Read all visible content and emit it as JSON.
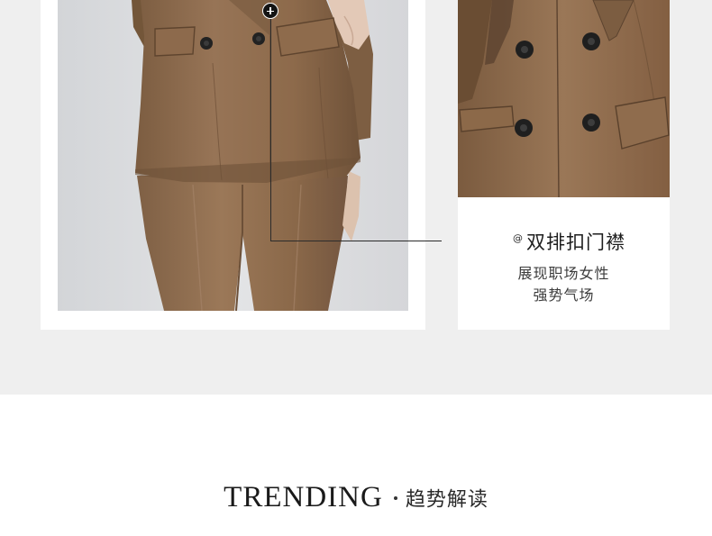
{
  "feature": {
    "at_symbol": "@",
    "title": "双排扣门襟",
    "desc_line1": "展现职场女性",
    "desc_line2": "强势气场"
  },
  "photos": {
    "main_alt": "Brown double-breasted suit jacket and trousers",
    "detail_alt": "Close-up of double-breasted buttons"
  },
  "section": {
    "heading_en": "TRENDING",
    "heading_cn": "趋势解读"
  },
  "colors": {
    "band_bg": "#efefef",
    "fabric": "#8e6c4c",
    "button": "#1f1f1f"
  }
}
